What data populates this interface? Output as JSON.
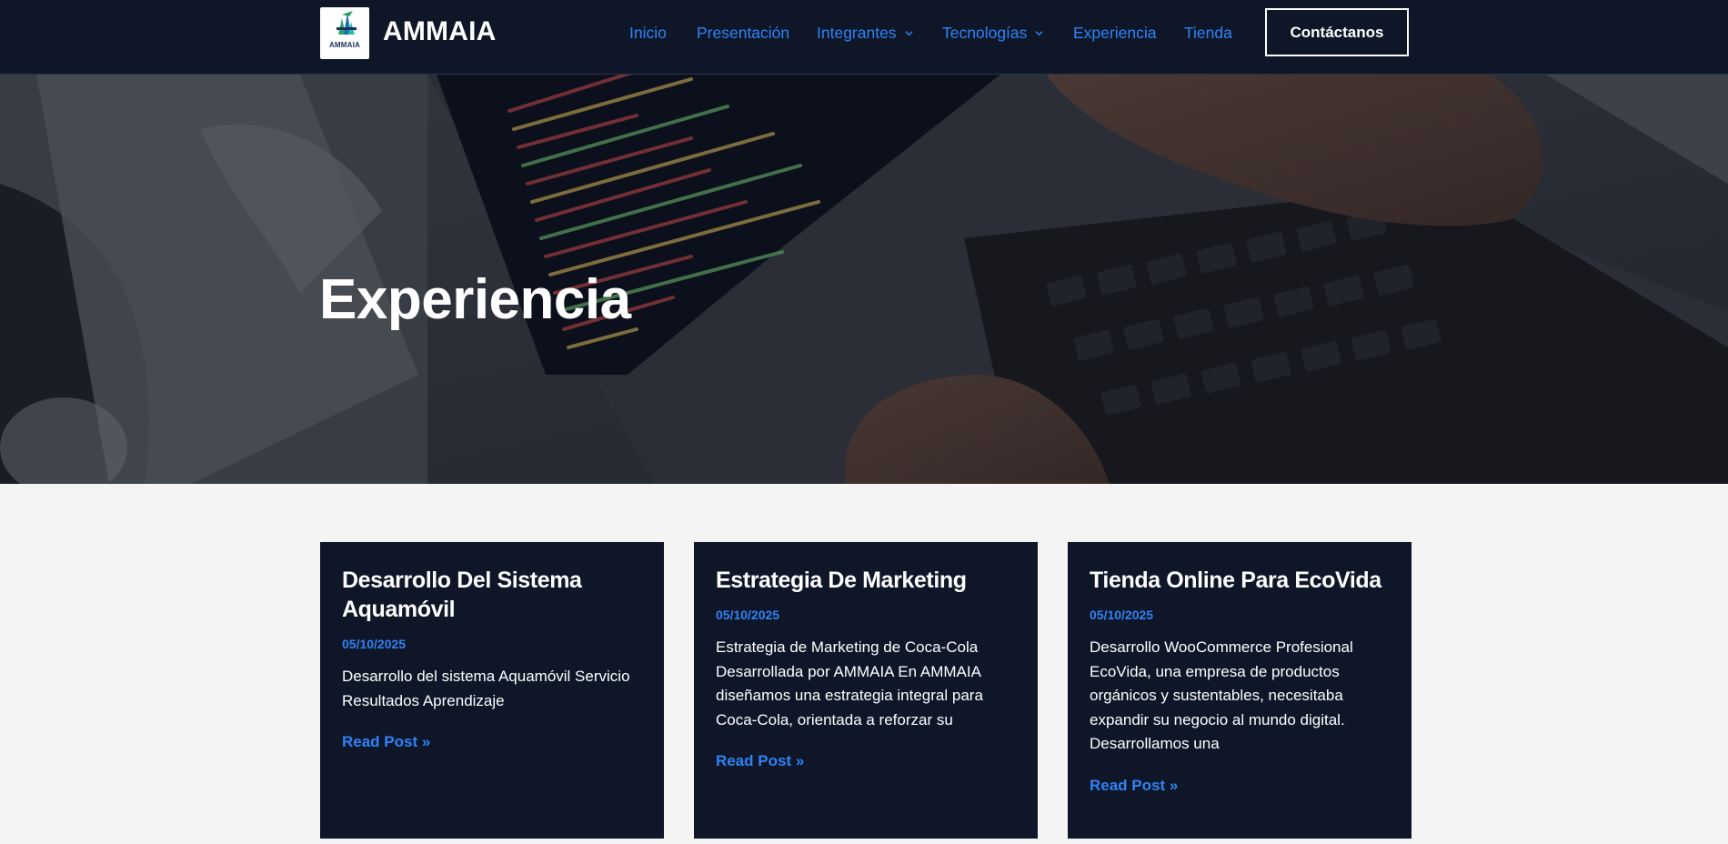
{
  "header": {
    "logo_text": "AMMAIA",
    "brand": "AMMAIA",
    "nav": [
      {
        "label": "Inicio"
      },
      {
        "label": "Presentación"
      },
      {
        "label": "Integrantes",
        "dropdown": true
      },
      {
        "label": "Tecnologías",
        "dropdown": true
      },
      {
        "label": "Experiencia"
      },
      {
        "label": "Tienda"
      }
    ],
    "cta_label": "Contáctanos"
  },
  "hero": {
    "title": "Experiencia"
  },
  "posts": [
    {
      "title": "Desarrollo Del Sistema Aquamóvil",
      "date": "05/10/2025",
      "excerpt": "Desarrollo del sistema Aquamóvil Servicio Resultados Aprendizaje",
      "link_label": "Read Post »"
    },
    {
      "title": "Estrategia De Marketing",
      "date": "05/10/2025",
      "excerpt": "Estrategia de Marketing de Coca-Cola Desarrollada por AMMAIA En AMMAIA diseñamos una estrategia integral para Coca-Cola, orientada a reforzar su",
      "link_label": "Read Post »"
    },
    {
      "title": "Tienda Online Para EcoVida",
      "date": "05/10/2025",
      "excerpt": "Desarrollo WooCommerce Profesional EcoVida, una empresa de productos orgánicos y sustentables, necesitaba expandir su negocio al mundo digital. Desarrollamos una",
      "link_label": "Read Post »"
    }
  ],
  "colors": {
    "header_bg": "#0e1628",
    "accent": "#2f83f6",
    "card_bg": "#0e1628",
    "page_bg": "#f4f4f4"
  },
  "icons": {
    "dropdown": "chevron-down-icon",
    "logo": "ammaia-logo"
  }
}
